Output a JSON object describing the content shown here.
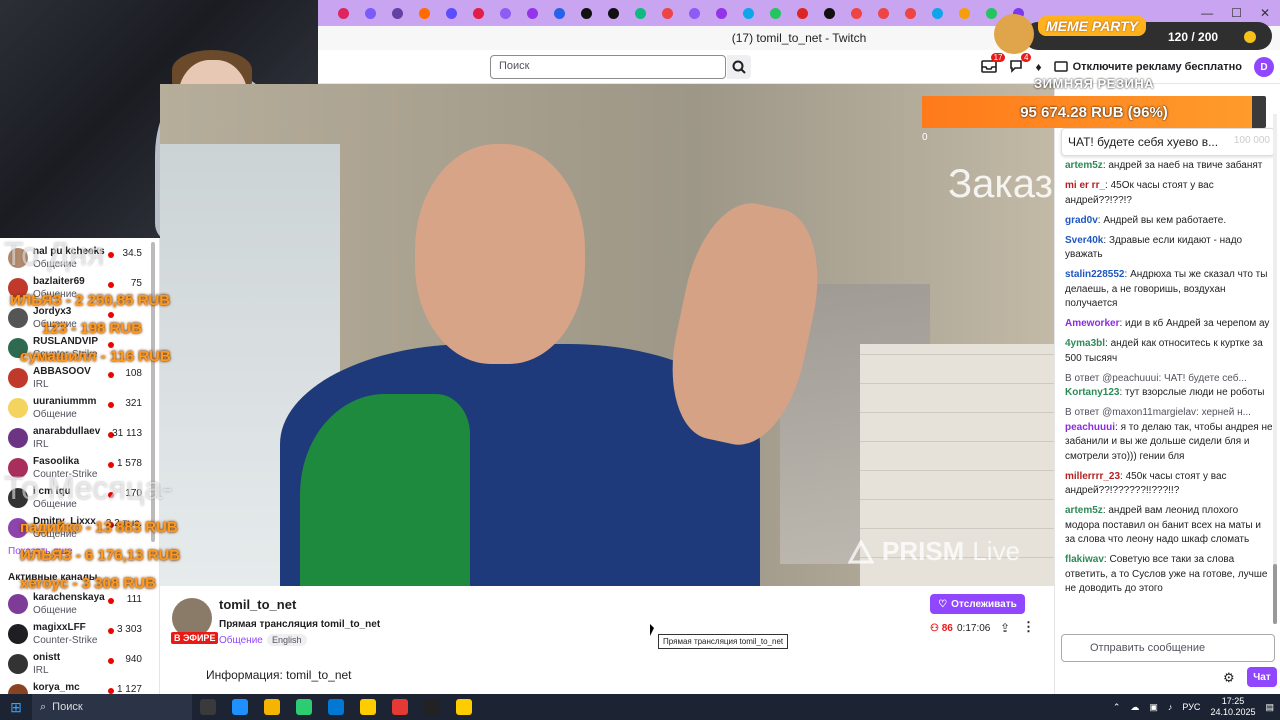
{
  "browser": {
    "window_title": "(17) tomil_to_net - Twitch",
    "tab_colors": [
      "#e0245e",
      "#7a5af8",
      "#6441a5",
      "#ff6b00",
      "#5b4dff",
      "#e11d48",
      "#8b5cf6",
      "#9333ea",
      "#2563eb",
      "#111111",
      "#111111",
      "#10b981",
      "#ef4444",
      "#8b5cf6",
      "#9333ea",
      "#0ea5e9",
      "#22c55e",
      "#dc2626",
      "#111111",
      "#ef4444",
      "#ef4444",
      "#ef4444",
      "#0ea5e9",
      "#f59e0b",
      "#22c55e",
      "#7c3aed"
    ],
    "win_controls": [
      "—",
      "☐",
      "✕"
    ]
  },
  "header": {
    "search_placeholder": "Поиск",
    "notif_count": "17",
    "inbox_count": "4",
    "ad_free": "Отключите рекламу бесплатно"
  },
  "meme_party": {
    "title": "MEME PARTY",
    "score": "120 / 200"
  },
  "goal": {
    "title": "ЗИМНЯЯ РЕЗИНА",
    "amount": "95 674.28 RUB (96%)",
    "percent": 96,
    "zero": "0",
    "max": "100 000"
  },
  "sidebar": {
    "channels": [
      {
        "name": "nal pu kcheeks",
        "category": "Общение",
        "viewers": "34.5",
        "color": "#b28b6e"
      },
      {
        "name": "bazlaiter69",
        "category": "Общение",
        "viewers": "75",
        "color": "#c0392b"
      },
      {
        "name": "Jordyx3",
        "category": "Общение",
        "viewers": "",
        "color": "#555555"
      },
      {
        "name": "RUSLANDVIP",
        "category": "Counter-Strike",
        "viewers": "",
        "color": "#2d6a4f"
      },
      {
        "name": "ABBASOOV",
        "category": "IRL",
        "viewers": "108",
        "color": "#c0392b"
      },
      {
        "name": "uuraniummm",
        "category": "Общение",
        "viewers": "321",
        "color": "#f4d35e"
      },
      {
        "name": "anarabdullaev",
        "category": "IRL",
        "viewers": "31 113",
        "color": "#6c3483"
      },
      {
        "name": "Fasoolika",
        "category": "Counter-Strike",
        "viewers": "1 578",
        "color": "#aa2e5b"
      },
      {
        "name": "i cm iqu",
        "category": "Общение",
        "viewers": "170",
        "color": "#333333"
      },
      {
        "name": "Dmitry_Lixxx",
        "category": "Общение",
        "viewers": "2,2 тыс.",
        "color": "#8e44ad"
      }
    ],
    "show_more": "Показать еще",
    "active_header": "Активные каналы",
    "active_channels": [
      {
        "name": "karachenskaya",
        "category": "Общение",
        "viewers": "111",
        "color": "#7d3c98"
      },
      {
        "name": "magixxLFF",
        "category": "Counter-Strike",
        "viewers": "3 303",
        "color": "#1f1f23"
      },
      {
        "name": "onistt",
        "category": "IRL",
        "viewers": "940",
        "color": "#333333"
      },
      {
        "name": "korya_mc",
        "category": "",
        "viewers": "1 127",
        "color": "#884422"
      }
    ]
  },
  "overlays": {
    "donations": [
      "ИЛЬЯЗ - 2 250,85 RUB",
      "123 - 198 RUB",
      "сумашилл - 116 RUB"
    ],
    "donations_bottom": [
      "падийко - 13 883 RUB",
      "ИЛЬЯЗ - 6 176,13 RUB",
      "xeroyc - 3 308 RUB"
    ],
    "ghost_top": "То Дня",
    "ghost_mid": "То Месяца-"
  },
  "video": {
    "overlay_text": "Заказ",
    "prism": "PRISM",
    "prism_live": "Live"
  },
  "stream": {
    "channel": "tomil_to_net",
    "live_badge": "В ЭФИРЕ",
    "title": "Прямая трансляция tomil_to_net",
    "category": "Общение",
    "language": "English",
    "follow_label": "Отслеживать",
    "viewers": "86",
    "uptime": "0:17:06",
    "tooltip": "Прямая трансляция tomil_to_net",
    "about": "Информация: tomil_to_net"
  },
  "chat": {
    "pinned": "ЧАТ! будете себя хуево в...",
    "messages": [
      {
        "user": "artem5z",
        "color": "#2e8b57",
        "text": "андрей за наеб на твиче забанят",
        "reply": ""
      },
      {
        "user": "mi er rr_",
        "color": "#b22222",
        "text": "45Ок часы стоят у вас андрей??!??!?",
        "reply": ""
      },
      {
        "user": "grad0v",
        "color": "#1e56c2",
        "text": "Андрей вы кем работаете.",
        "reply": ""
      },
      {
        "user": "Sver40k",
        "color": "#1e56c2",
        "text": "Здравые если кидают - надо уважать",
        "reply": ""
      },
      {
        "user": "stalin228552",
        "color": "#1e56c2",
        "text": "Андрюха ты же сказал что ты делаешь, а не говоришь, воздухан получается",
        "reply": ""
      },
      {
        "user": "Ameworker",
        "color": "#8a2be2",
        "text": "иди в кб Андрей за черепом ау",
        "reply": ""
      },
      {
        "user": "4yma3bl",
        "color": "#2e8b57",
        "text": "андей как относитесь к куртке за 500 тысяяч",
        "reply": ""
      },
      {
        "user": "Kortany123",
        "color": "#2e8b57",
        "text": "тут взорслые люди не роботы",
        "reply": "В ответ @peachuuui: ЧАТ! будете себ..."
      },
      {
        "user": "peachuuui",
        "color": "#8a2be2",
        "text": "я то делаю так, чтобы андрея не забанили и вы же дольше сидели бля и смотрели это))) гении бля",
        "reply": "В ответ @maxon11margielav: херней н..."
      },
      {
        "user": "millerrrr_23",
        "color": "#b22222",
        "text": "450к часы стоят у вас андрей??!??????!!???!!?",
        "reply": ""
      },
      {
        "user": "artem5z",
        "color": "#2e8b57",
        "text": "андрей вам леонид плохого модора поставил он банит всех на маты и за слова что леону надо шкаф сломать",
        "reply": ""
      },
      {
        "user": "flakiwav",
        "color": "#2e8b57",
        "text": "Советую все таки за слова ответить, а то Суслов уже на готове, лучше не доводить до этого",
        "reply": ""
      }
    ],
    "input_placeholder": "Отправить сообщение",
    "send_label": "Чат"
  },
  "taskbar": {
    "search_label": "Поиск",
    "apps": [
      "#3a3a3a",
      "#1e90ff",
      "#f4b400",
      "#2ecc71",
      "#0078d4",
      "#ffcc00",
      "#e53935",
      "#222222",
      "#ffcc00"
    ],
    "language": "РУС",
    "time": "17:25",
    "date": "24.10.2025"
  }
}
